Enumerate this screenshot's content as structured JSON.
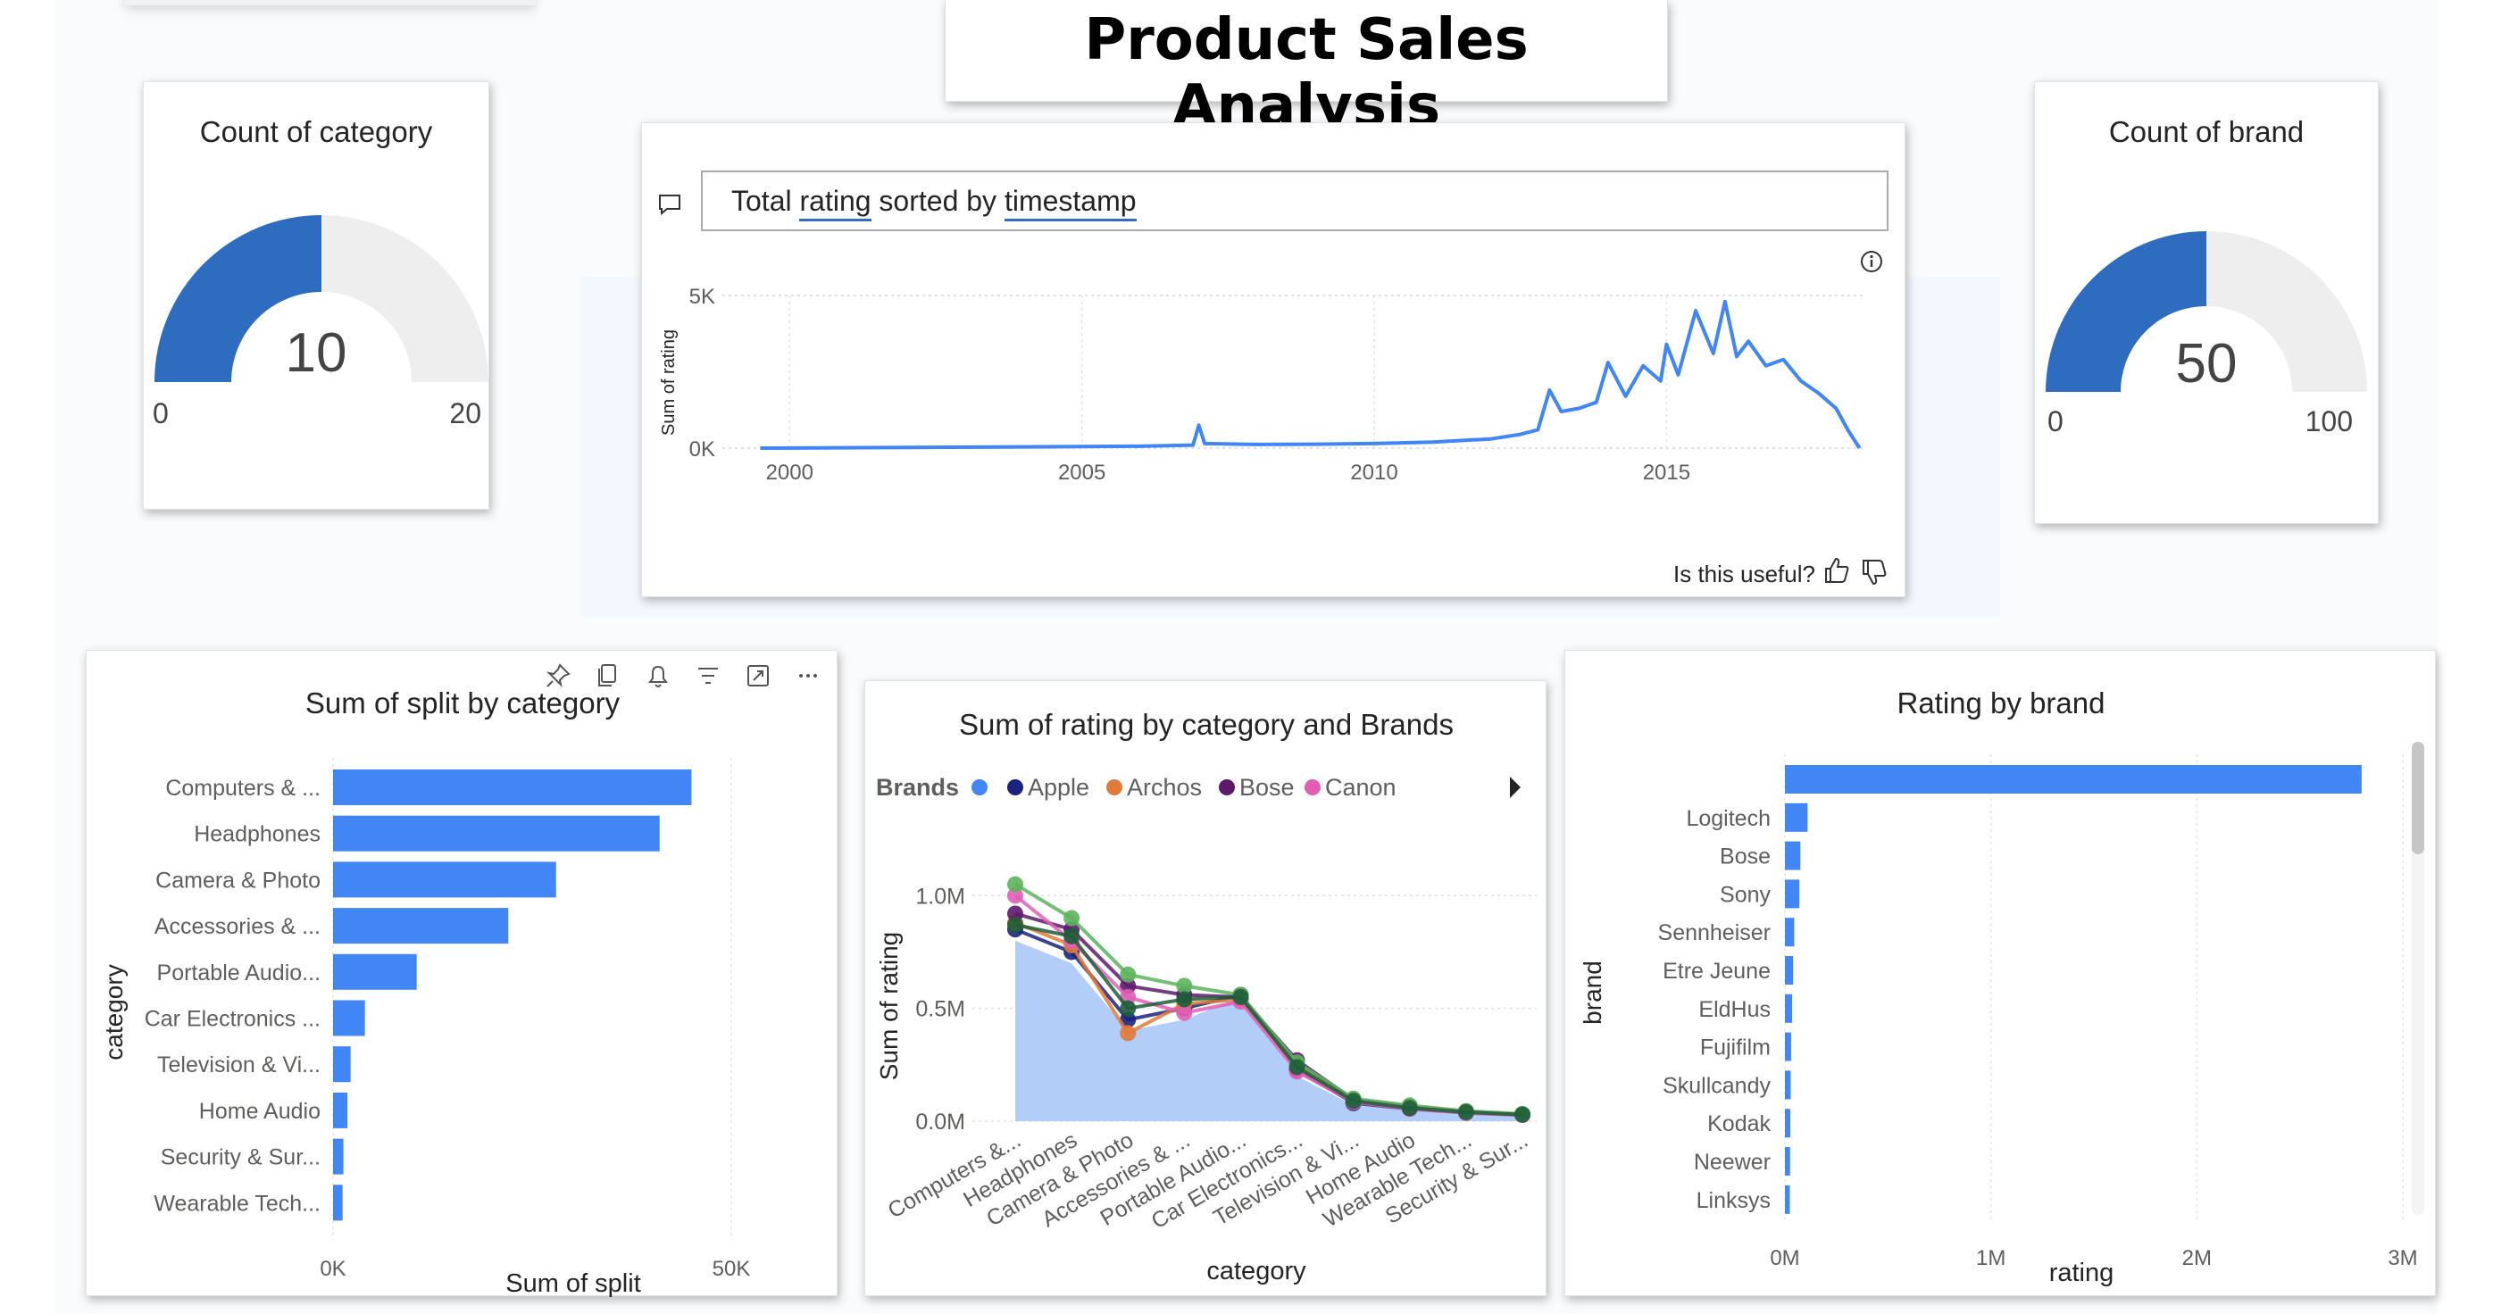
{
  "page": {
    "title": "Product Sales Analysis"
  },
  "colors": {
    "accent": "#2d6cbf",
    "bar": "#4285f4",
    "gauge_track": "#eeeeee",
    "text": "#252423",
    "muted": "#605e5c"
  },
  "gauge_category": {
    "title": "Count of category",
    "value": "10",
    "min": "0",
    "max": "20",
    "fraction": 0.5
  },
  "gauge_brand": {
    "title": "Count of brand",
    "value": "50",
    "min": "0",
    "max": "100",
    "fraction": 0.5
  },
  "qna": {
    "question_prefix": "Total",
    "question_word1": "rating",
    "question_middle": "sorted by",
    "question_word2": "timestamp",
    "feedback_label": "Is this useful?",
    "icons": [
      "chat-icon",
      "info-icon",
      "thumbs-up-icon",
      "thumbs-down-icon"
    ]
  },
  "split_chart": {
    "toolbar_icons": [
      "pin-icon",
      "copy-icon",
      "bell-icon",
      "filter-icon",
      "focus-mode-icon",
      "more-options-icon"
    ]
  },
  "rating_chart": {
    "legend_title": "Brands",
    "legend_items": [
      {
        "name": "Apple",
        "color": "#1a237e"
      },
      {
        "name": "Archos",
        "color": "#e07a3a"
      },
      {
        "name": "Bose",
        "color": "#5c1a6b"
      },
      {
        "name": "Canon",
        "color": "#e05fb5"
      }
    ]
  },
  "chart_data": [
    {
      "type": "line",
      "title": "",
      "xlabel": "",
      "ylabel": "Sum of rating",
      "x_ticks": [
        "2000",
        "2005",
        "2010",
        "2015"
      ],
      "y_ticks": [
        "0K",
        "5K"
      ],
      "xlim": [
        1999.4,
        2018.4
      ],
      "ylim": [
        0,
        5000
      ],
      "series": [
        {
          "x": [
            1999.5,
            2002,
            2004,
            2006,
            2006.9,
            2007.0,
            2007.1,
            2008,
            2009,
            2010,
            2011,
            2012,
            2012.5,
            2012.8,
            2013.0,
            2013.2,
            2013.5,
            2013.8,
            2014.0,
            2014.3,
            2014.6,
            2014.9,
            2015.0,
            2015.2,
            2015.5,
            2015.8,
            2016.0,
            2016.2,
            2016.4,
            2016.7,
            2017.0,
            2017.3,
            2017.6,
            2017.9,
            2018.1,
            2018.3
          ],
          "y": [
            0,
            20,
            40,
            60,
            100,
            750,
            150,
            120,
            130,
            150,
            200,
            300,
            450,
            600,
            1900,
            1200,
            1300,
            1500,
            2800,
            1700,
            2700,
            2200,
            3400,
            2400,
            4500,
            3100,
            4800,
            3000,
            3500,
            2700,
            2900,
            2200,
            1800,
            1300,
            600,
            0
          ]
        }
      ]
    },
    {
      "type": "bar",
      "title": "Sum of split by category",
      "xlabel": "Sum of split",
      "ylabel": "category",
      "orientation": "horizontal",
      "categories": [
        "Computers & ...",
        "Headphones",
        "Camera & Photo",
        "Accessories & ...",
        "Portable Audio...",
        "Car Electronics ...",
        "Television & Vi...",
        "Home Audio",
        "Security & Sur...",
        "Wearable Tech..."
      ],
      "values": [
        45000,
        41000,
        28000,
        22000,
        10500,
        4000,
        2200,
        1800,
        1300,
        1200
      ],
      "x_ticks": [
        "0K",
        "50K"
      ],
      "xlim": [
        0,
        50000
      ],
      "grid": true
    },
    {
      "type": "area",
      "title": "Sum of rating by category and Brands",
      "xlabel": "category",
      "ylabel": "Sum of rating",
      "categories": [
        "Computers &...",
        "Headphones",
        "Camera & Photo",
        "Accessories & ...",
        "Portable Audio...",
        "Car Electronics...",
        "Television & Vi...",
        "Home Audio",
        "Wearable Tech...",
        "Security & Sur..."
      ],
      "y_ticks": [
        "0.0M",
        "0.5M",
        "1.0M"
      ],
      "ylim": [
        0,
        1100000
      ],
      "series": [
        {
          "name": "",
          "color": "#aac8f7",
          "values": [
            800000,
            700000,
            400000,
            450000,
            550000,
            200000,
            70000,
            50000,
            35000,
            25000
          ]
        },
        {
          "name": "Apple",
          "color": "#1a237e",
          "values": [
            850000,
            750000,
            450000,
            500000,
            560000,
            230000,
            80000,
            55000,
            38000,
            28000
          ]
        },
        {
          "name": "Archos",
          "color": "#e07a3a",
          "values": [
            880000,
            780000,
            390000,
            520000,
            540000,
            250000,
            90000,
            60000,
            40000,
            30000
          ]
        },
        {
          "name": "Bose",
          "color": "#5c1a6b",
          "values": [
            920000,
            850000,
            600000,
            560000,
            550000,
            270000,
            95000,
            65000,
            42000,
            30000
          ]
        },
        {
          "name": "Canon",
          "color": "#e05fb5",
          "values": [
            1000000,
            800000,
            550000,
            480000,
            530000,
            220000,
            85000,
            55000,
            36000,
            27000
          ]
        },
        {
          "name": "",
          "color": "#5db35d",
          "values": [
            1050000,
            900000,
            650000,
            600000,
            560000,
            260000,
            100000,
            70000,
            45000,
            32000
          ]
        },
        {
          "name": "",
          "color": "#1e5e3a",
          "values": [
            870000,
            820000,
            500000,
            540000,
            550000,
            240000,
            90000,
            58000,
            40000,
            29000
          ]
        }
      ],
      "legend": "top"
    },
    {
      "type": "bar",
      "title": "Rating by brand",
      "xlabel": "rating",
      "ylabel": "brand",
      "orientation": "horizontal",
      "categories": [
        "",
        "Logitech",
        "Bose",
        "Sony",
        "Sennheiser",
        "Etre Jeune",
        "EldHus",
        "Fujifilm",
        "Skullcandy",
        "Kodak",
        "Neewer",
        "Linksys"
      ],
      "values": [
        2800000,
        110000,
        75000,
        70000,
        45000,
        40000,
        35000,
        30000,
        28000,
        26000,
        25000,
        24000
      ],
      "x_ticks": [
        "0M",
        "1M",
        "2M",
        "3M"
      ],
      "xlim": [
        0,
        3000000
      ],
      "grid": true
    }
  ]
}
